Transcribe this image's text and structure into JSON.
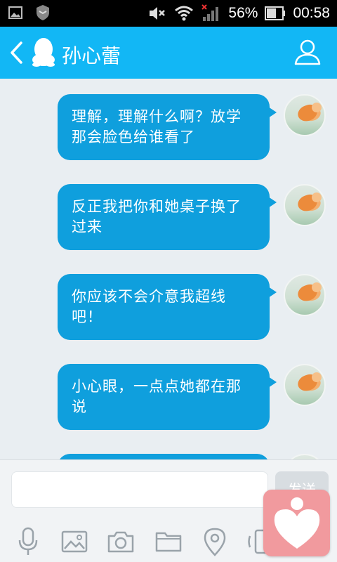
{
  "status_bar": {
    "battery": "56%",
    "time": "00:58"
  },
  "header": {
    "title": "孙心蕾"
  },
  "messages": [
    {
      "text": "理解，理解什么啊？放学那会脸色给谁看了"
    },
    {
      "text": "反正我把你和她桌子换了过来"
    },
    {
      "text": "你应该不会介意我超线吧！"
    },
    {
      "text": "小心眼，一点点她都在那说"
    }
  ],
  "input": {
    "send_label": "发送"
  },
  "colors": {
    "header": "#12b7f5",
    "bubble": "#0f9fdd",
    "badge": "#f19a9e"
  }
}
